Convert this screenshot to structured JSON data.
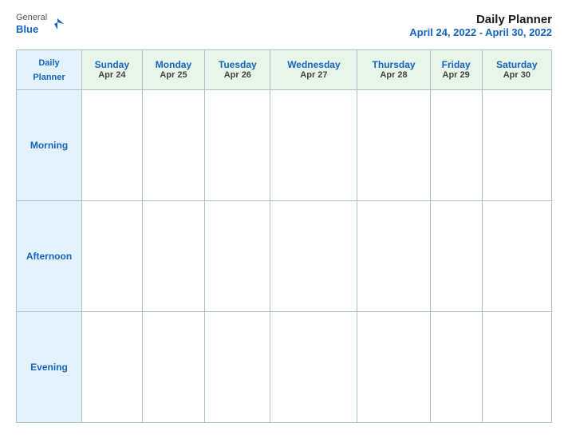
{
  "logo": {
    "general": "General",
    "blue": "Blue",
    "icon_color": "#1565c0"
  },
  "title": {
    "main": "Daily Planner",
    "date_range": "April 24, 2022 - April 30, 2022"
  },
  "header_col": {
    "line1": "Daily",
    "line2": "Planner"
  },
  "days": [
    {
      "name": "Sunday",
      "date": "Apr 24"
    },
    {
      "name": "Monday",
      "date": "Apr 25"
    },
    {
      "name": "Tuesday",
      "date": "Apr 26"
    },
    {
      "name": "Wednesday",
      "date": "Apr 27"
    },
    {
      "name": "Thursday",
      "date": "Apr 28"
    },
    {
      "name": "Friday",
      "date": "Apr 29"
    },
    {
      "name": "Saturday",
      "date": "Apr 30"
    }
  ],
  "time_slots": [
    {
      "label": "Morning"
    },
    {
      "label": "Afternoon"
    },
    {
      "label": "Evening"
    }
  ]
}
